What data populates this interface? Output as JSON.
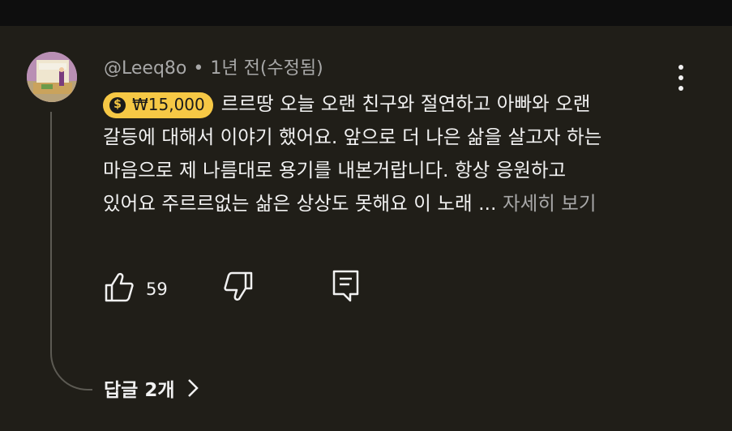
{
  "comment": {
    "author": "@Leeq8o",
    "separator": "•",
    "time": "1년 전(수정됨)",
    "super_thanks": {
      "icon": "$",
      "amount": "₩15,000"
    },
    "lines": [
      "르르땅 오늘 오랜 친구와 절연하고 아빠와 오랜",
      "갈등에 대해서 이야기 했어요. 앞으로 더 나은 삶을 살고자 하는",
      "마음으로 제 나름대로 용기를 내본거랍니다. 항상 응원하고",
      "있어요 주르르없는 삶은 상상도 못해요 이 노래 ..."
    ],
    "read_more": "자세히 보기",
    "like_count": "59",
    "replies_label": "답글 2개"
  },
  "icons": [
    "thumbs-up-icon",
    "thumbs-down-icon",
    "reply-icon",
    "more-vert-icon",
    "chevron-right-icon",
    "dollar-coin-icon"
  ],
  "colors": {
    "background": "#201e18",
    "badge": "#f6c845",
    "muted_text": "#a8a8a8"
  }
}
